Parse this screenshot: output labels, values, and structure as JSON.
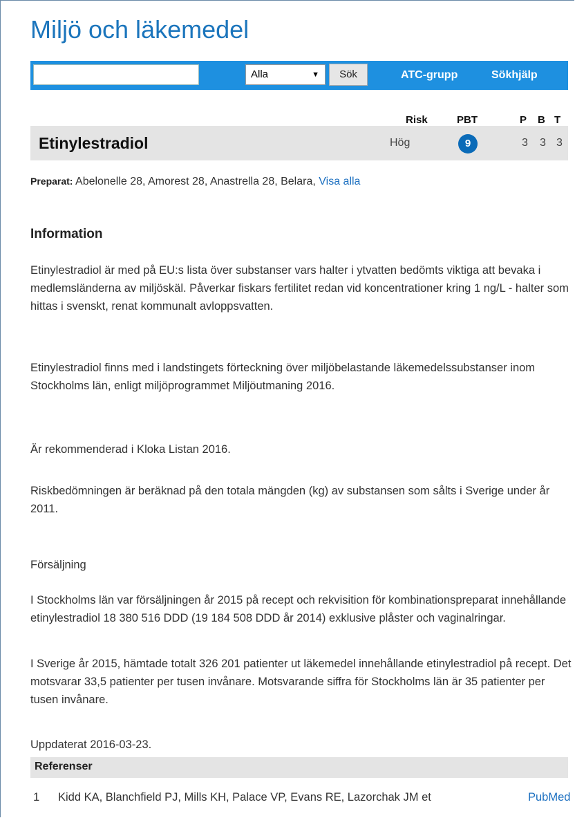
{
  "app": {
    "title": "Miljö och läkemedel"
  },
  "search": {
    "value": "",
    "placeholder": "",
    "select_value": "Alla",
    "button_label": "Sök"
  },
  "nav": {
    "atc": "ATC-grupp",
    "help": "Sökhjälp"
  },
  "table_header": {
    "risk": "Risk",
    "pbt": "PBT",
    "p": "P",
    "b": "B",
    "t": "T"
  },
  "substance": {
    "name": "Etinylestradiol",
    "risk": "Hög",
    "pbt": "9",
    "p": "3",
    "b": "3",
    "t": "3"
  },
  "preparat": {
    "label": "Preparat:",
    "list": "Abelonelle 28, Amorest 28, Anastrella 28, Belara,",
    "show_all": "Visa alla"
  },
  "information": {
    "heading": "Information",
    "paragraphs": [
      "Etinylestradiol är med på EU:s lista över substanser vars halter i ytvatten bedömts viktiga att bevaka i medlemsländerna av miljöskäl. Påverkar fiskars fertilitet redan vid koncentrationer kring 1 ng/L - halter som hittas i svenskt, renat kommunalt avloppsvatten.",
      "Etinylestradiol finns med i landstingets förteckning över miljöbelastande läkemedelssubstanser inom Stockholms län, enligt miljöprogrammet Miljöutmaning 2016.",
      "Är rekommenderad i Kloka Listan 2016.",
      "Riskbedömningen är beräknad på den totala mängden (kg) av substansen som sålts i Sverige under år 2011.",
      "Försäljning",
      "I Stockholms län var försäljningen år 2015 på recept och rekvisition för kombinationspreparat innehållande etinylestradiol 18 380 516 DDD (19 184 508 DDD år 2014) exklusive plåster och vaginalringar.",
      "I Sverige år 2015, hämtade totalt 326 201 patienter ut läkemedel innehållande etinylestradiol på recept. Det motsvarar 33,5 patienter per tusen invånare. Motsvarande siffra för Stockholms län är 35 patienter per tusen invånare.",
      "Uppdaterat 2016-03-23."
    ]
  },
  "references": {
    "heading": "Referenser",
    "items": [
      {
        "num": "1",
        "text": "Kidd KA, Blanchfield PJ, Mills KH, Palace VP, Evans RE, Lazorchak JM et",
        "link": "PubMed"
      }
    ]
  },
  "colors": {
    "accent": "#1b75bc",
    "bar": "#1e90e0",
    "badge": "#0b6bb8",
    "panel": "#e4e4e4"
  }
}
